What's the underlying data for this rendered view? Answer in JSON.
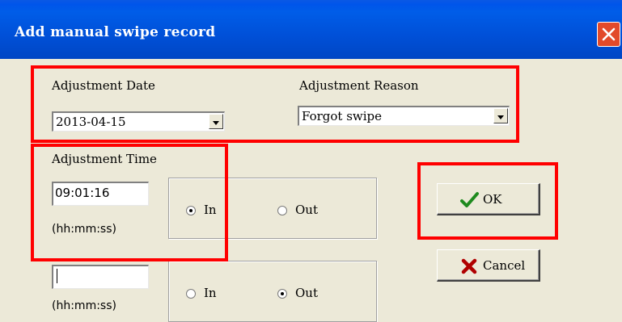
{
  "window": {
    "title": "Add manual swipe record",
    "close_icon": "close-icon"
  },
  "date": {
    "label": "Adjustment Date",
    "value": "2013-04-15"
  },
  "reason": {
    "label": "Adjustment Reason",
    "value": "Forgot swipe"
  },
  "time": {
    "label": "Adjustment Time",
    "entry1": {
      "value": "09:01:16",
      "format": "(hh:mm:ss)",
      "in_label": "In",
      "out_label": "Out",
      "selected": "In"
    },
    "entry2": {
      "value": "",
      "format": "(hh:mm:ss)",
      "in_label": "In",
      "out_label": "Out",
      "selected": "Out"
    }
  },
  "buttons": {
    "ok": {
      "label": "OK",
      "icon": "checkmark-icon"
    },
    "cancel": {
      "label": "Cancel",
      "icon": "x-icon"
    }
  },
  "highlight_color": "#ff0000"
}
